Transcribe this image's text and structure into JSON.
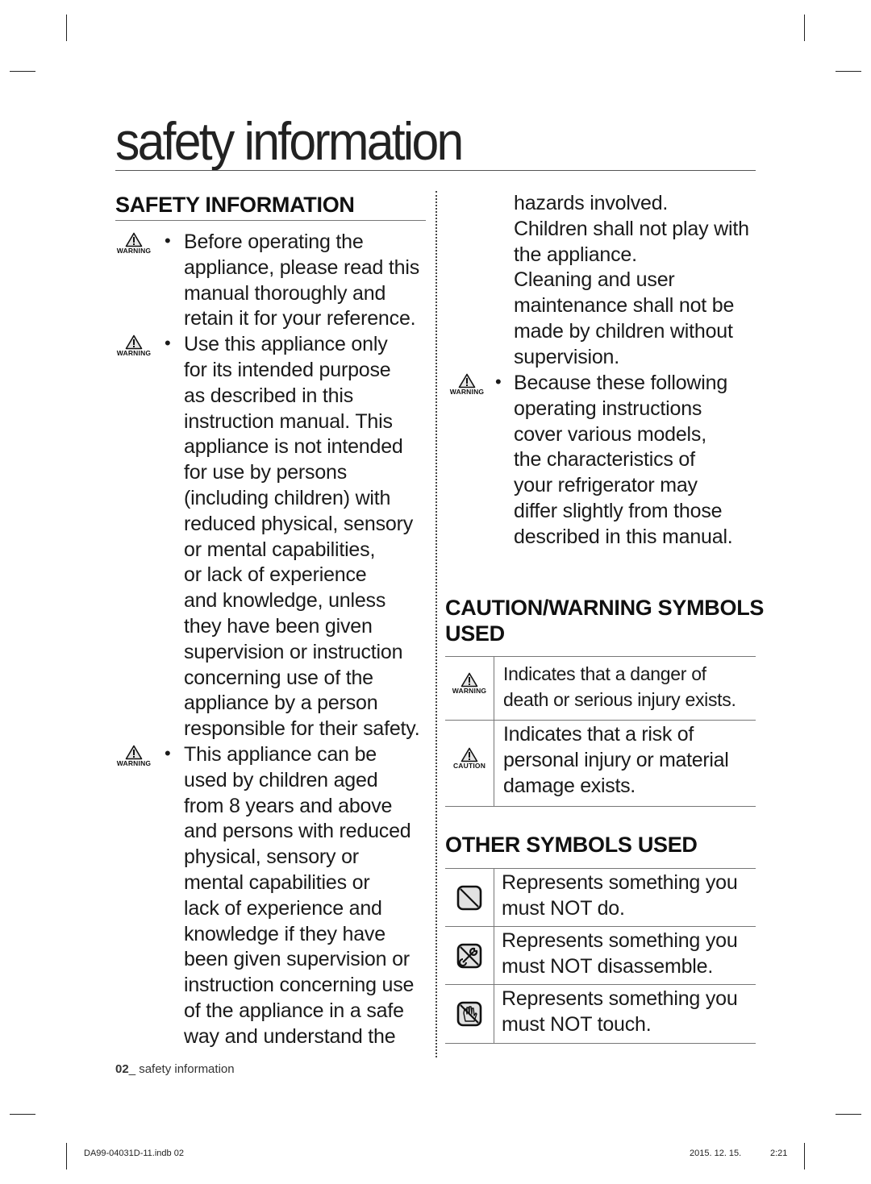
{
  "page": {
    "title": "safety information",
    "page_number": "02",
    "footer_label": "_ safety information"
  },
  "left_column": {
    "heading": "SAFETY INFORMATION",
    "items": [
      {
        "badge": "WARNING",
        "lines": [
          "Before operating the",
          "appliance, please read this",
          "manual thoroughly and",
          "retain it for your reference."
        ]
      },
      {
        "badge": "WARNING",
        "lines": [
          "Use this appliance only",
          "for its intended purpose",
          "as described in this",
          "instruction manual. This",
          "appliance is not intended",
          "for use by persons",
          "(including children) with",
          "reduced physical, sensory",
          "or mental capabilities,",
          "or lack of experience",
          "and knowledge, unless",
          "they have been given",
          "supervision or instruction",
          "concerning use of the",
          "appliance by a person",
          "responsible for their safety."
        ]
      },
      {
        "badge": "WARNING",
        "lines": [
          "This appliance can be",
          "used by children aged",
          "from 8 years and above",
          "and persons with reduced",
          "physical, sensory or",
          "mental capabilities or",
          "lack of experience and",
          "knowledge if they have",
          "been given supervision or",
          "instruction concerning use",
          "of the appliance in a safe",
          "way and understand the"
        ]
      }
    ]
  },
  "right_column": {
    "continuation_lines": [
      "hazards involved.",
      "Children shall not play with",
      "the appliance.",
      "Cleaning and user",
      "maintenance shall not be",
      "made by children without",
      "supervision."
    ],
    "item": {
      "badge": "WARNING",
      "lines": [
        "Because these following",
        "operating instructions",
        "cover various models,",
        "the characteristics of",
        "your refrigerator may",
        "differ slightly from those",
        "described in this manual."
      ]
    },
    "caution_heading": [
      "CAUTION/WARNING SYMBOLS",
      "USED"
    ],
    "caution_rows": [
      {
        "icon": "warning-triangle-icon",
        "badge": "WARNING",
        "lines": [
          "Indicates that a danger of",
          "death or serious injury exists."
        ]
      },
      {
        "icon": "caution-triangle-icon",
        "badge": "CAUTION",
        "lines": [
          "Indicates that a risk of",
          "personal injury or material",
          "damage exists."
        ]
      }
    ],
    "other_heading": "OTHER SYMBOLS USED",
    "other_rows": [
      {
        "icon": "prohibited-icon",
        "lines": [
          "Represents something you",
          "must NOT do."
        ]
      },
      {
        "icon": "no-disassemble-icon",
        "lines": [
          "Represents something you",
          "must NOT disassemble."
        ]
      },
      {
        "icon": "no-touch-icon",
        "lines": [
          "Represents something you",
          "must NOT touch."
        ]
      }
    ]
  },
  "print_info": {
    "file": "DA99-04031D-11.indb   02",
    "date": "2015. 12. 15.",
    "time": "2:21"
  }
}
